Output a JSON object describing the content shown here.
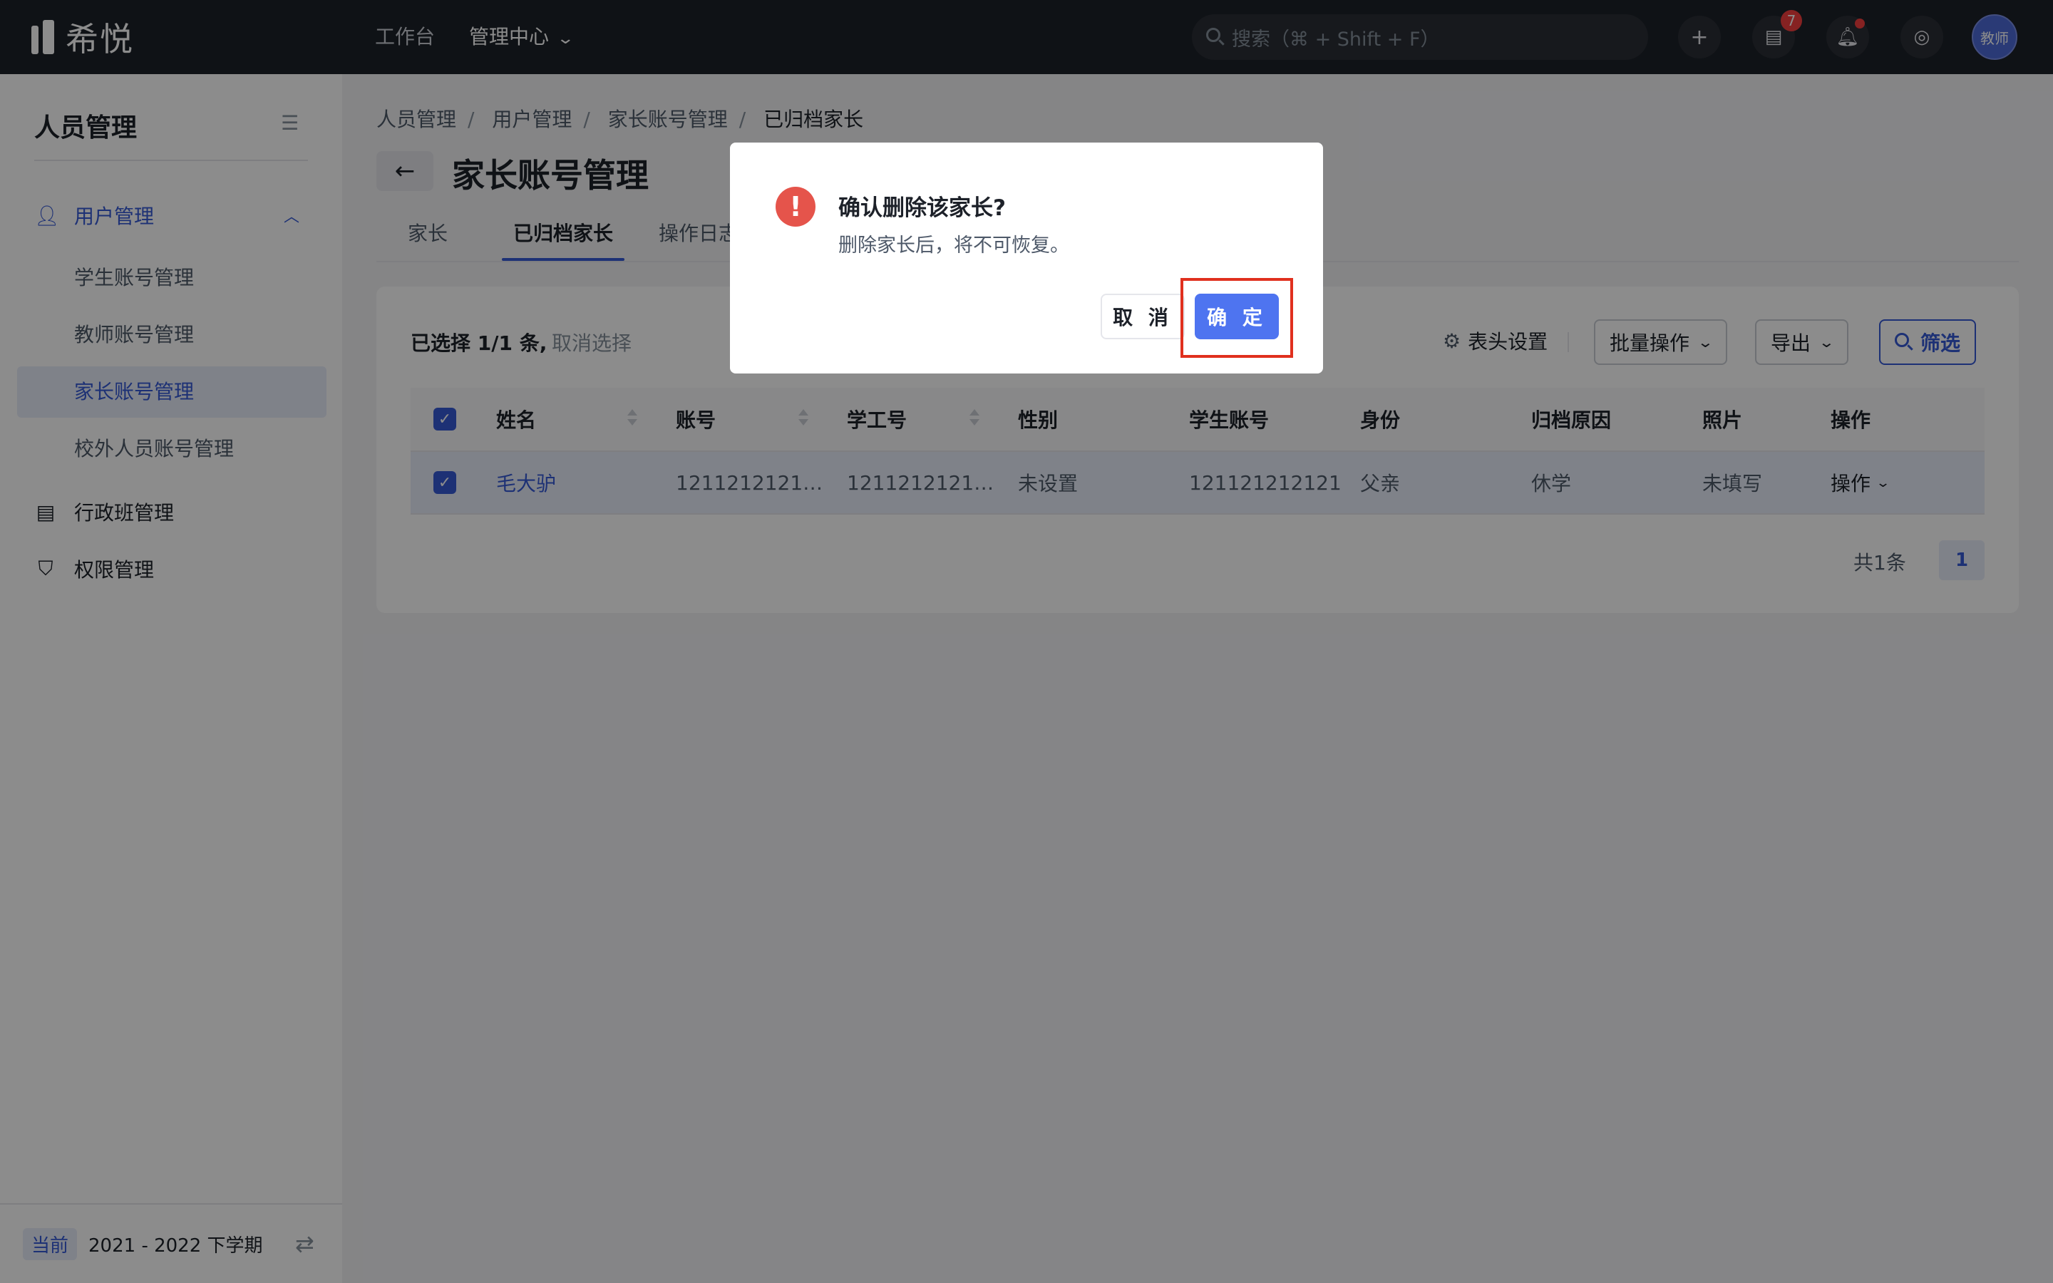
{
  "topbar": {
    "logo_text": "希悦",
    "nav": [
      {
        "label": "工作台"
      },
      {
        "label": "管理中心"
      }
    ],
    "search_placeholder": "搜索（⌘ + Shift + F）",
    "message_badge": "7",
    "avatar_label": "教师"
  },
  "sidebar": {
    "title": "人员管理",
    "groups": [
      {
        "label": "用户管理",
        "icon": "user-icon"
      },
      {
        "label": "行政班管理",
        "icon": "class-icon"
      },
      {
        "label": "权限管理",
        "icon": "shield-icon"
      }
    ],
    "items": [
      {
        "label": "学生账号管理"
      },
      {
        "label": "教师账号管理"
      },
      {
        "label": "家长账号管理"
      },
      {
        "label": "校外人员账号管理"
      }
    ],
    "footer": {
      "tag": "当前",
      "term": "2021 - 2022 下学期"
    }
  },
  "main": {
    "breadcrumb": [
      "人员管理",
      "用户管理",
      "家长账号管理",
      "已归档家长"
    ],
    "breadcrumb_sep": "/",
    "page_title": "家长账号管理",
    "tabs": [
      {
        "label": "家长"
      },
      {
        "label": "已归档家长"
      },
      {
        "label": "操作日志"
      }
    ]
  },
  "toolbar": {
    "selected_text": "已选择 1/1 条,",
    "deselect_label": "取消选择",
    "header_settings_label": "表头设置",
    "batch_label": "批量操作",
    "export_label": "导出",
    "filter_label": "筛选"
  },
  "table": {
    "columns": [
      "姓名",
      "账号",
      "学工号",
      "性别",
      "学生账号",
      "身份",
      "归档原因",
      "照片",
      "操作"
    ],
    "rows": [
      {
        "name": "毛大驴",
        "account": "1211212121…",
        "staff_id": "1211212121…",
        "gender": "未设置",
        "student_account": "121121212121",
        "identity": "父亲",
        "archive_reason": "休学",
        "photo": "未填写",
        "action": "操作"
      }
    ]
  },
  "pagination": {
    "total": "共1条",
    "current_page": "1"
  },
  "modal": {
    "title": "确认删除该家长?",
    "message": "删除家长后，将不可恢复。",
    "cancel_label": "取 消",
    "ok_label": "确 定"
  },
  "colors": {
    "accent": "#3659d6",
    "danger": "#e5544b",
    "highlight": "#e0301e",
    "topbar": "#1d2129"
  }
}
